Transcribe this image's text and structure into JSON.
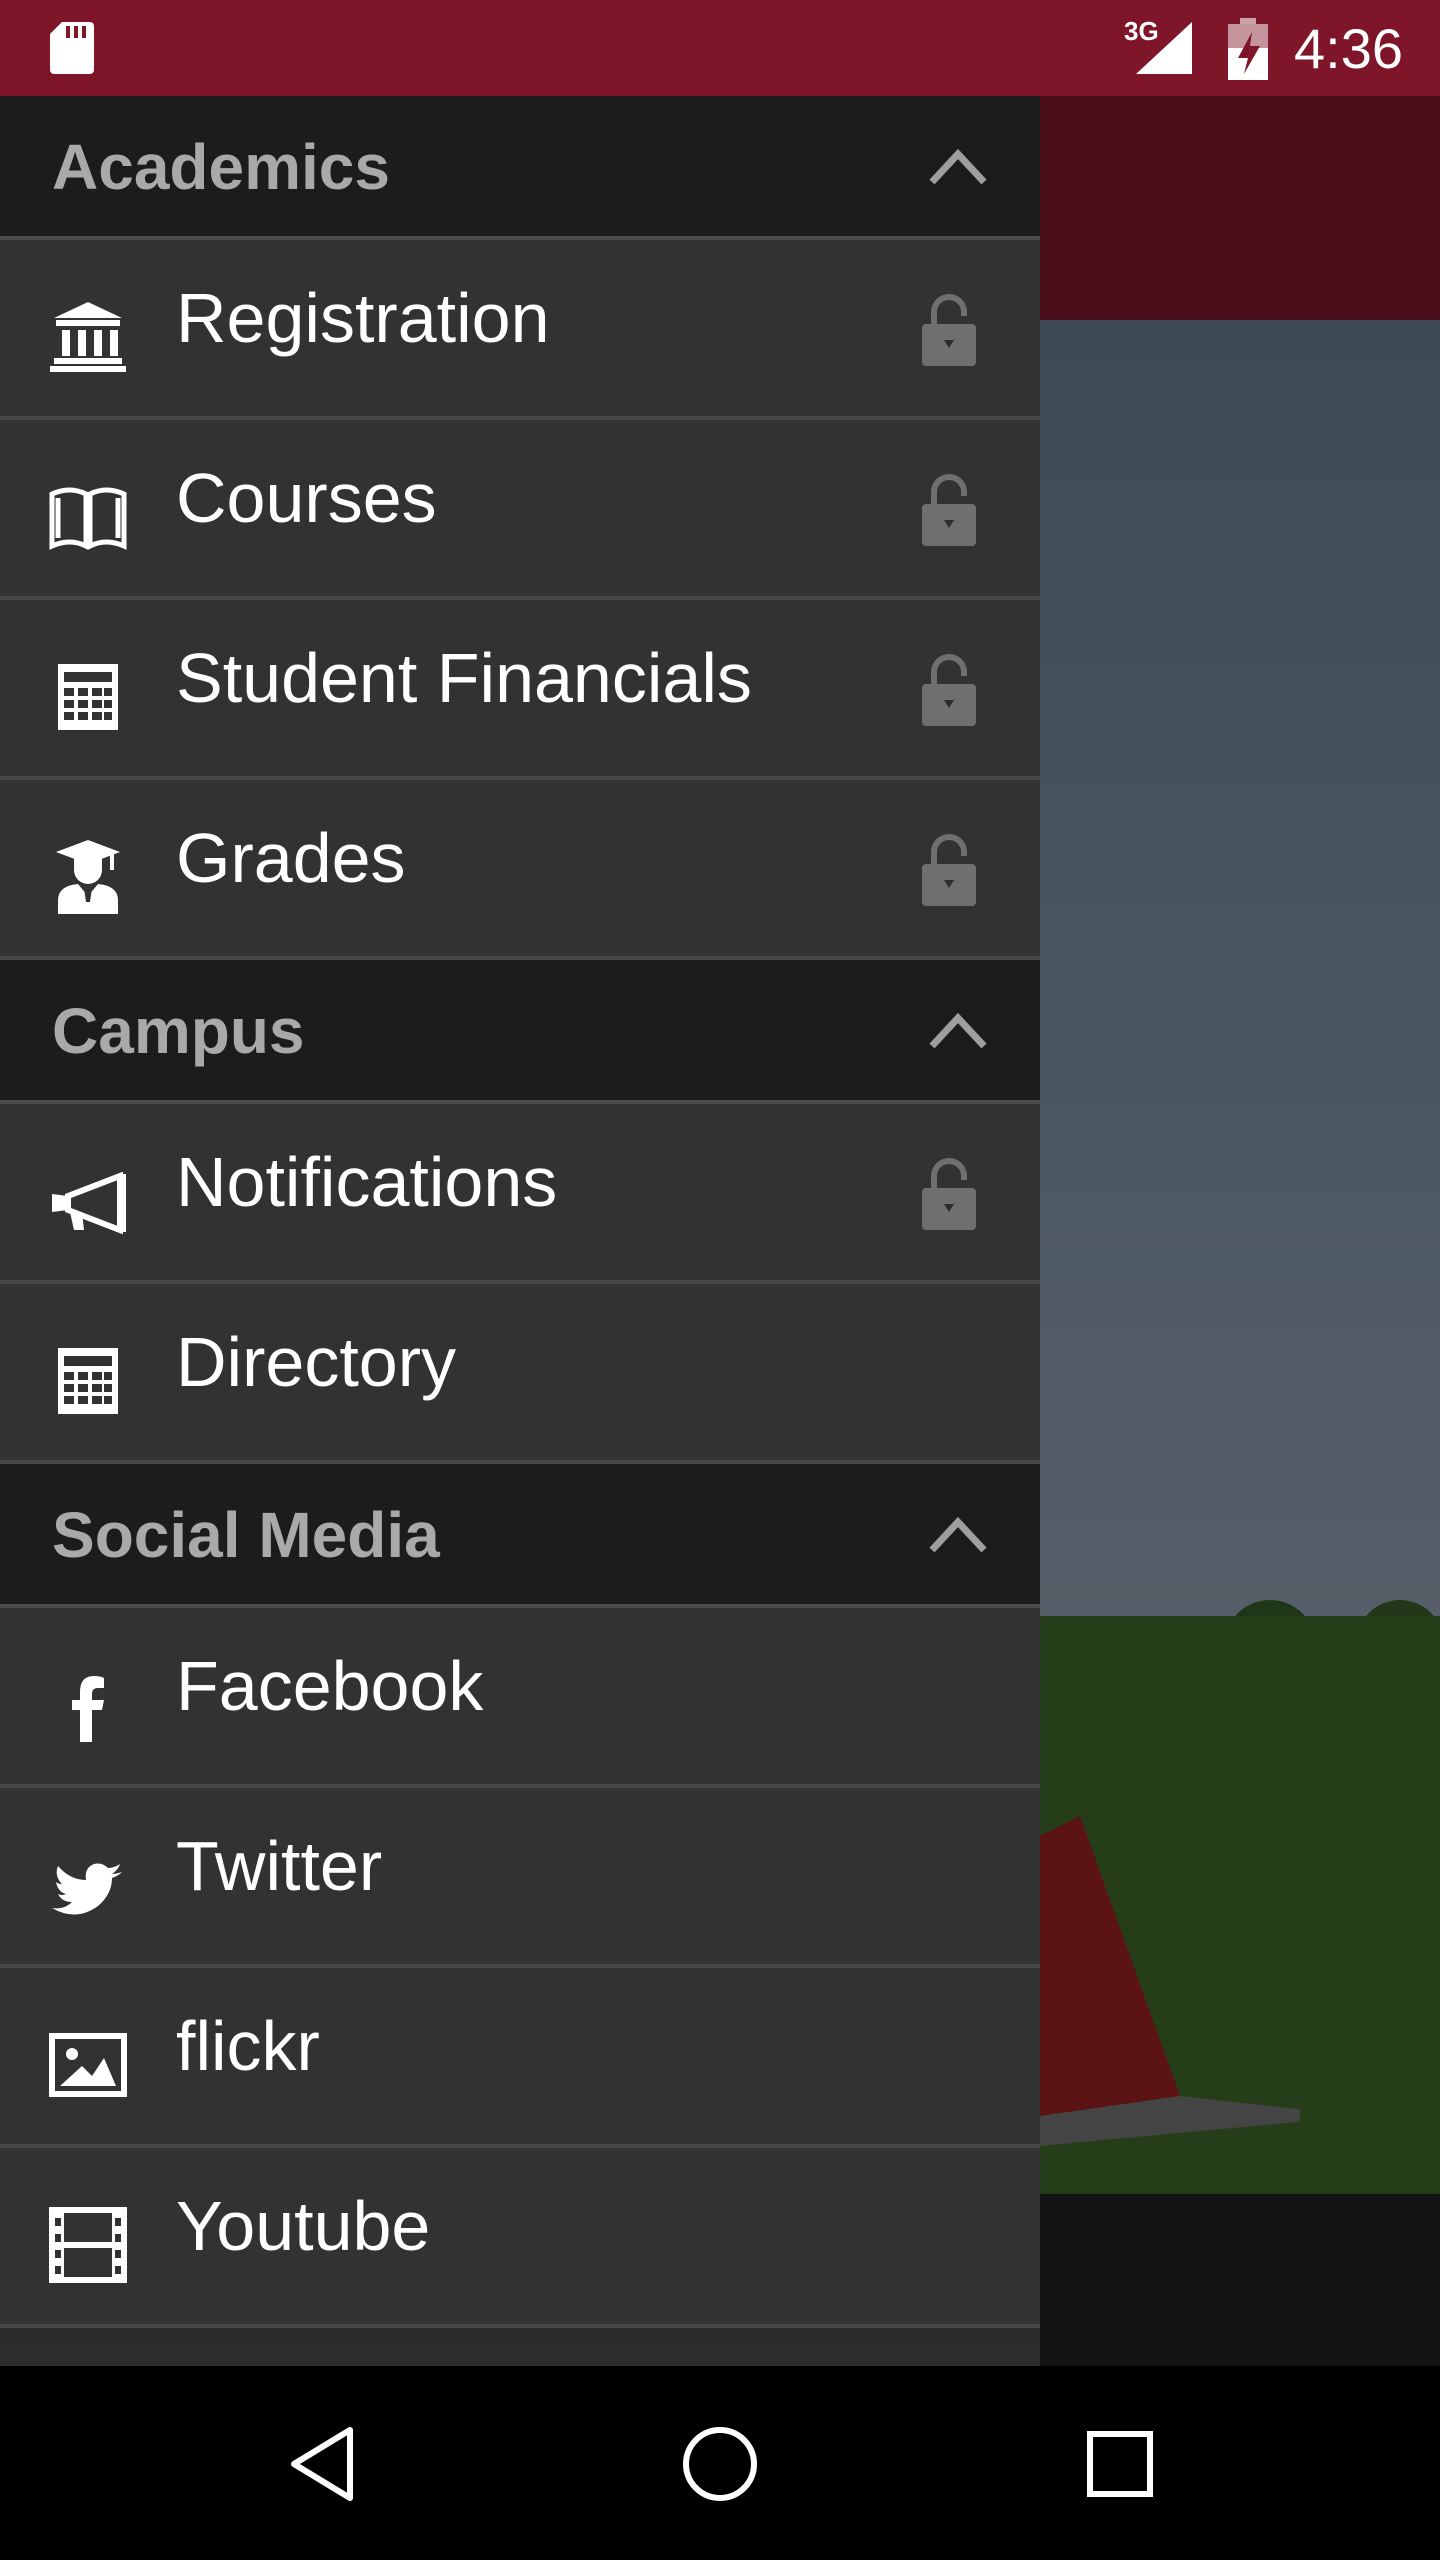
{
  "status_bar": {
    "network": "3G",
    "time": "4:36",
    "icons": [
      "sd-card-icon",
      "signal-icon",
      "battery-charging-icon"
    ],
    "color": "#7e1528"
  },
  "drawer": {
    "sections": [
      {
        "title": "Academics",
        "items": [
          {
            "label": "Registration",
            "icon": "bank-icon",
            "locked": true
          },
          {
            "label": "Courses",
            "icon": "book-icon",
            "locked": true
          },
          {
            "label": "Student Financials",
            "icon": "calculator-icon",
            "locked": true
          },
          {
            "label": "Grades",
            "icon": "graduate-icon",
            "locked": true
          }
        ]
      },
      {
        "title": "Campus",
        "items": [
          {
            "label": "Notifications",
            "icon": "megaphone-icon",
            "locked": true
          },
          {
            "label": "Directory",
            "icon": "calculator-icon",
            "locked": false
          }
        ]
      },
      {
        "title": "Social Media",
        "items": [
          {
            "label": "Facebook",
            "icon": "facebook-icon",
            "locked": false
          },
          {
            "label": "Twitter",
            "icon": "twitter-icon",
            "locked": false
          },
          {
            "label": "flickr",
            "icon": "picture-icon",
            "locked": false
          },
          {
            "label": "Youtube",
            "icon": "film-icon",
            "locked": false
          }
        ]
      }
    ]
  },
  "nav_bar": {
    "icons": [
      "back-icon",
      "home-icon",
      "recents-icon"
    ]
  }
}
